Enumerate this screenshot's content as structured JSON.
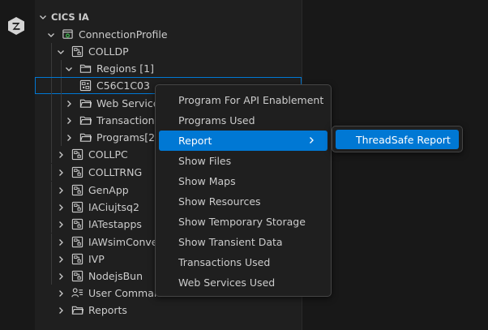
{
  "tree": {
    "section_title": "CICS IA",
    "items": [
      {
        "label": "ConnectionProfile",
        "icon": "connection-profile-icon",
        "expanded": true
      },
      {
        "label": "COLLDP",
        "icon": "region-node-icon",
        "expanded": true
      },
      {
        "label": "Regions [1]",
        "icon": "folder-icon",
        "expanded": true
      },
      {
        "label": "C56C1C03",
        "icon": "region-icon",
        "selected": true
      },
      {
        "label": "Web Services",
        "icon": "folder-icon",
        "expanded": false
      },
      {
        "label": "Transactions [",
        "icon": "folder-icon",
        "expanded": false
      },
      {
        "label": "Programs[2]",
        "icon": "folder-icon",
        "expanded": false
      },
      {
        "label": "COLLPC",
        "icon": "region-node-icon",
        "expanded": false
      },
      {
        "label": "COLLTRNG",
        "icon": "region-node-icon",
        "expanded": false
      },
      {
        "label": "GenApp",
        "icon": "region-node-icon",
        "expanded": false
      },
      {
        "label": "IACiujtsq2",
        "icon": "region-node-icon",
        "expanded": false
      },
      {
        "label": "IATestapps",
        "icon": "region-node-icon",
        "expanded": false
      },
      {
        "label": "IAWsimConvert",
        "icon": "region-node-icon",
        "expanded": false
      },
      {
        "label": "IVP",
        "icon": "region-node-icon",
        "expanded": false
      },
      {
        "label": "NodejsBun",
        "icon": "region-node-icon",
        "expanded": false
      },
      {
        "label": "User Command Flow",
        "icon": "user-command-flow-icon",
        "expanded": false
      },
      {
        "label": "Reports",
        "icon": "folder-open-icon",
        "expanded": false
      }
    ]
  },
  "context_menu": {
    "items": [
      {
        "label": "Program For API Enablement"
      },
      {
        "label": "Programs Used"
      },
      {
        "label": "Report",
        "active": true,
        "has_submenu": true
      },
      {
        "label": "Show Files"
      },
      {
        "label": "Show Maps"
      },
      {
        "label": "Show Resources"
      },
      {
        "label": "Show Temporary Storage"
      },
      {
        "label": "Show Transient Data"
      },
      {
        "label": "Transactions Used"
      },
      {
        "label": "Web Services Used"
      }
    ]
  },
  "submenu": {
    "items": [
      {
        "label": "ThreadSafe Report",
        "active": true
      }
    ]
  },
  "colors": {
    "accent": "#0078d4",
    "background": "#181818",
    "panel": "#1f1f1f",
    "text": "#cccccc"
  }
}
